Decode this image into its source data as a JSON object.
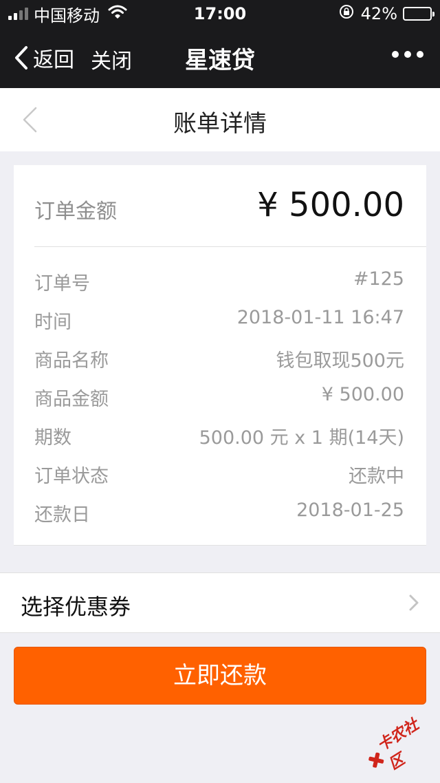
{
  "status_bar": {
    "carrier": "中国移动",
    "time": "17:00",
    "battery": "42%",
    "battery_level": 0.42,
    "icons": [
      "signal-icon",
      "wifi-icon",
      "rotation-lock-icon",
      "battery-icon"
    ]
  },
  "nav": {
    "back_label": "返回",
    "close_label": "关闭",
    "title": "星速贷",
    "more_icon": "more-icon"
  },
  "page": {
    "title": "账单详情",
    "back_icon": "chevron-left-icon"
  },
  "order": {
    "amount_label": "订单金额",
    "amount_value": "¥ 500.00",
    "details": [
      {
        "label": "订单号",
        "value": "#125"
      },
      {
        "label": "时间",
        "value": "2018-01-11 16:47"
      },
      {
        "label": "商品名称",
        "value": "钱包取现500元"
      },
      {
        "label": "商品金额",
        "value": "¥ 500.00"
      },
      {
        "label": "期数",
        "value": "500.00 元 x 1 期(14天)"
      },
      {
        "label": "订单状态",
        "value": "还款中"
      },
      {
        "label": "还款日",
        "value": "2018-01-25"
      }
    ]
  },
  "coupon": {
    "label": "选择优惠券",
    "icon": "chevron-right-icon"
  },
  "actions": {
    "pay_label": "立即还款"
  },
  "watermark": {
    "text": "卡农社区"
  },
  "colors": {
    "nav_bg": "#1a1a1c",
    "page_bg": "#efeff4",
    "accent": "#ff6100",
    "watermark": "#d0251b"
  }
}
